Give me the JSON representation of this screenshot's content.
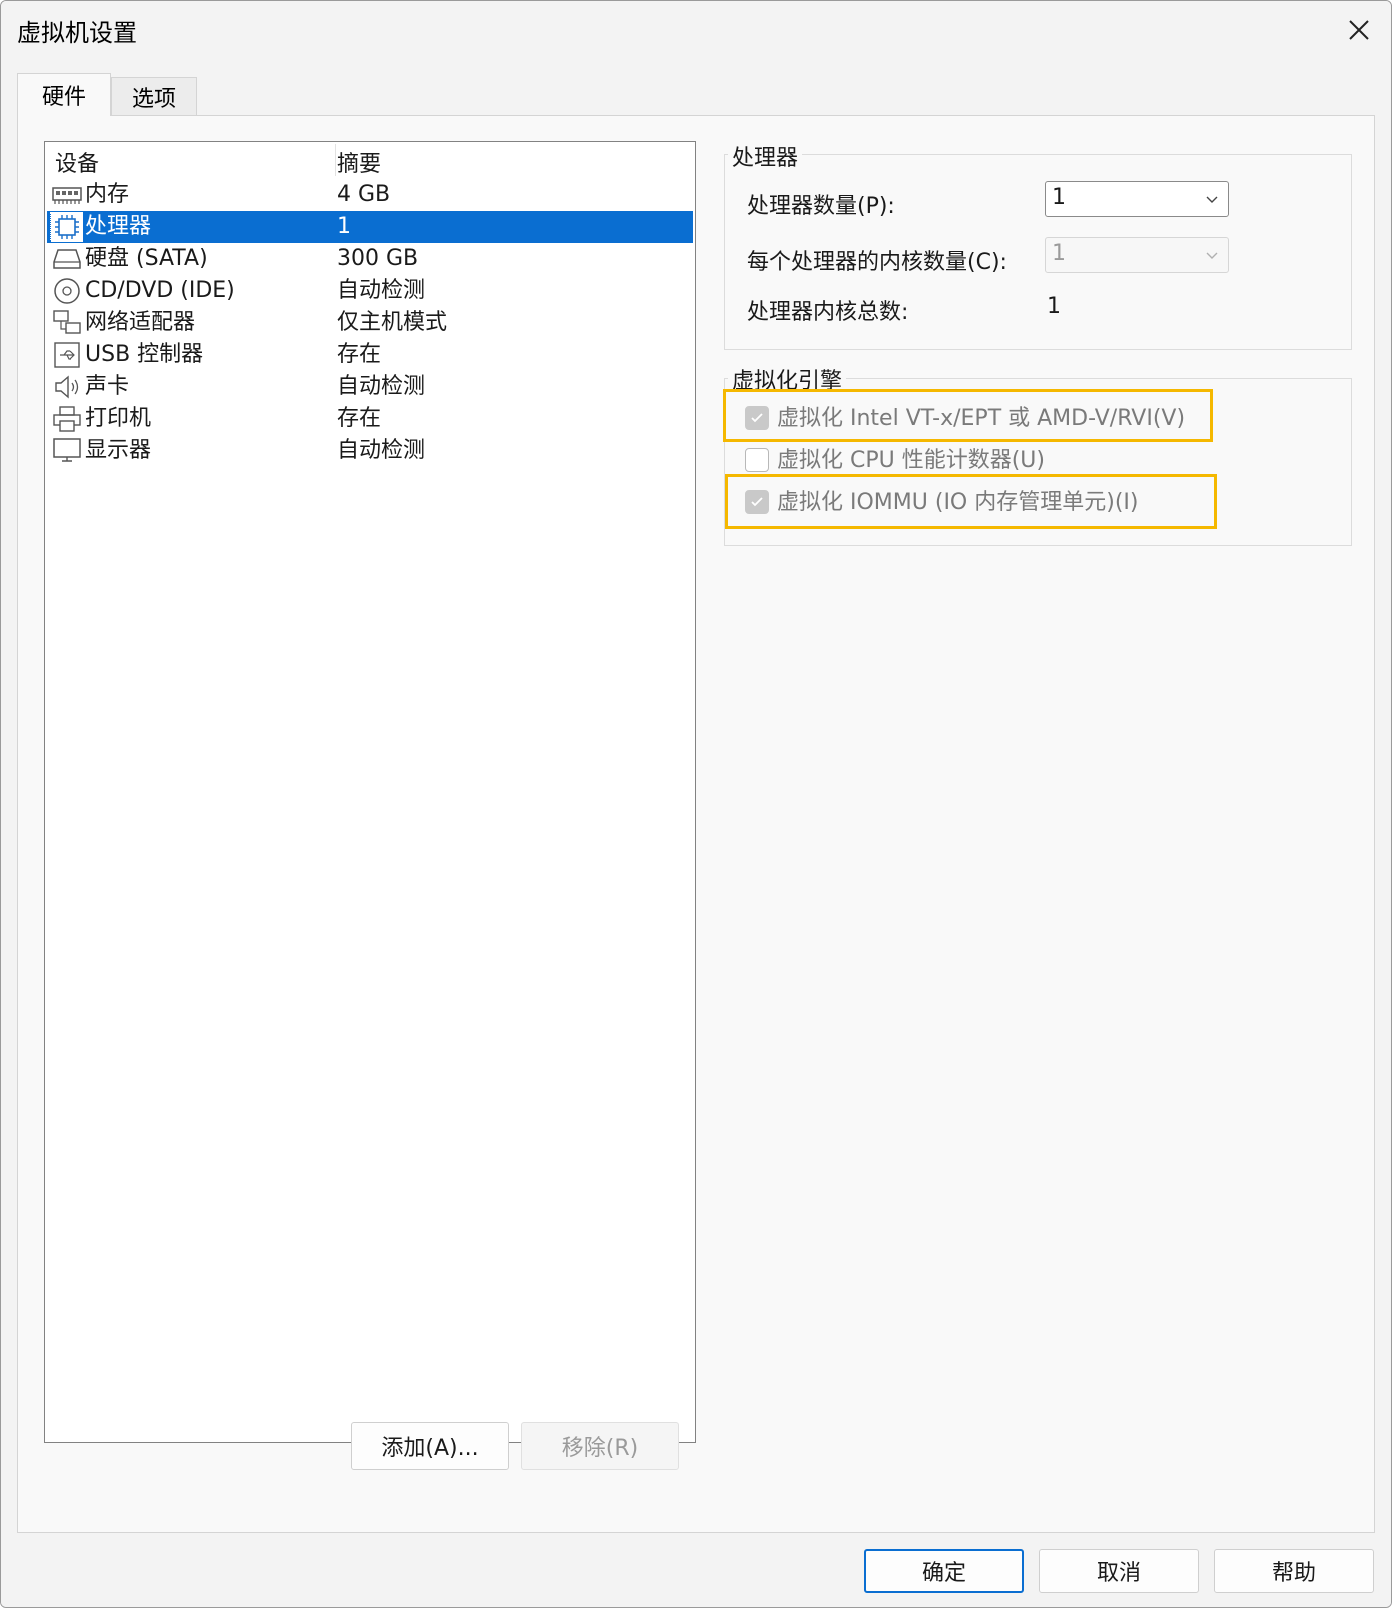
{
  "window": {
    "title": "虚拟机设置",
    "close_label": "✕"
  },
  "tabs": [
    {
      "label": "硬件"
    },
    {
      "label": "选项"
    }
  ],
  "device_list": {
    "columns": [
      "设备",
      "摘要"
    ],
    "rows": [
      {
        "name": "内存",
        "summary": "4 GB",
        "icon": "memory-icon"
      },
      {
        "name": "处理器",
        "summary": "1",
        "icon": "processor-icon",
        "selected": true
      },
      {
        "name": "硬盘 (SATA)",
        "summary": "300 GB",
        "icon": "hard-disk-icon"
      },
      {
        "name": "CD/DVD (IDE)",
        "summary": "自动检测",
        "icon": "cd-dvd-icon"
      },
      {
        "name": "网络适配器",
        "summary": "仅主机模式",
        "icon": "network-adapter-icon"
      },
      {
        "name": "USB 控制器",
        "summary": "存在",
        "icon": "usb-icon"
      },
      {
        "name": "声卡",
        "summary": "自动检测",
        "icon": "speaker-icon"
      },
      {
        "name": "打印机",
        "summary": "存在",
        "icon": "printer-icon"
      },
      {
        "name": "显示器",
        "summary": "自动检测",
        "icon": "monitor-icon"
      }
    ]
  },
  "list_buttons": {
    "add": "添加(A)...",
    "remove": "移除(R)"
  },
  "processor_group": {
    "title": "处理器",
    "count_label": "处理器数量(P):",
    "count_value": "1",
    "cores_label": "每个处理器的内核数量(C):",
    "cores_value": "1",
    "total_label": "处理器内核总数:",
    "total_value": "1"
  },
  "virt_group": {
    "title": "虚拟化引擎",
    "options": [
      {
        "label": "虚拟化 Intel VT-x/EPT 或 AMD-V/RVI(V)",
        "checked": true,
        "highlighted": true
      },
      {
        "label": "虚拟化 CPU 性能计数器(U)",
        "checked": false,
        "highlighted": false
      },
      {
        "label": "虚拟化 IOMMU (IO 内存管理单元)(I)",
        "checked": true,
        "highlighted": true
      }
    ],
    "highlight_color": "#f5b800"
  },
  "dialog_buttons": {
    "ok": "确定",
    "cancel": "取消",
    "help": "帮助"
  },
  "colors": {
    "selection": "#0a6ed1",
    "dialog_bg": "#f3f3f3"
  }
}
